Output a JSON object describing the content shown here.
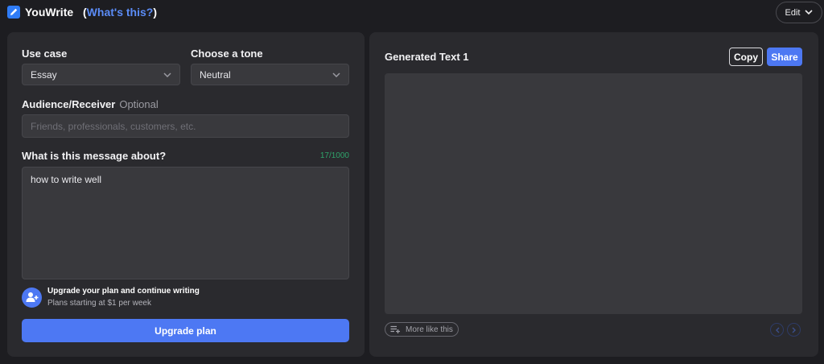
{
  "app": {
    "name": "YouWrite",
    "whats_this_open": "(",
    "whats_this_link": "What's this?",
    "whats_this_close": ")",
    "edit_label": "Edit"
  },
  "form": {
    "use_case": {
      "label": "Use case",
      "value": "Essay"
    },
    "tone": {
      "label": "Choose a tone",
      "value": "Neutral"
    },
    "audience": {
      "label": "Audience/Receiver",
      "optional": "Optional",
      "placeholder": "Friends, professionals, customers, etc.",
      "value": ""
    },
    "message": {
      "label": "What is this message about?",
      "counter": "17/1000",
      "value": "how to write well"
    }
  },
  "upgrade": {
    "title": "Upgrade your plan and continue writing",
    "subtitle": "Plans starting at $1 per week",
    "button_label": "Upgrade plan"
  },
  "output": {
    "title": "Generated Text 1",
    "copy_label": "Copy",
    "share_label": "Share",
    "more_label": "More like this"
  },
  "colors": {
    "accent": "#4d78f3",
    "background": "#1d1d21",
    "panel": "#2a2a2e",
    "counter": "#2fa46b"
  },
  "icons": {
    "logo": "pen-icon",
    "edit_dropdown": "chevron-down-icon",
    "select": "chevron-down-icon",
    "avatar": "user-plus-icon",
    "more": "list-add-icon",
    "prev": "chevron-left-icon",
    "next": "chevron-right-icon"
  }
}
